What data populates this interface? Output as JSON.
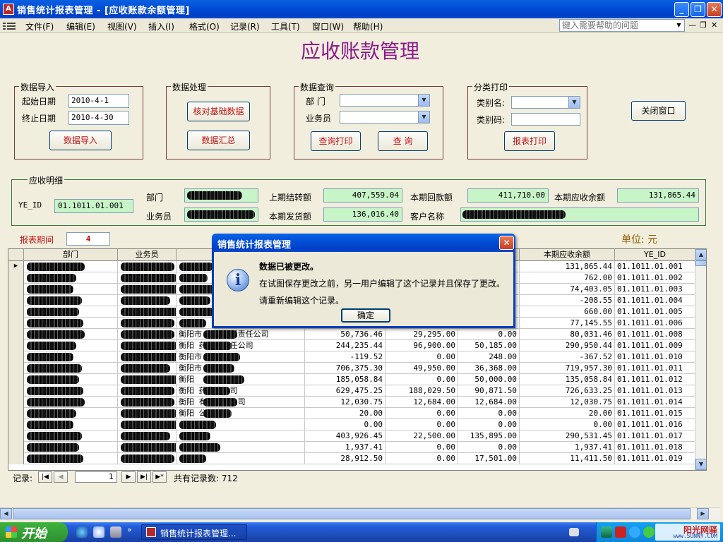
{
  "window": {
    "title": "销售统计报表管理 - [应收账款余额管理]"
  },
  "menu": [
    "文件(F)",
    "编辑(E)",
    "视图(V)",
    "插入(I)",
    "格式(O)",
    "记录(R)",
    "工具(T)",
    "窗口(W)",
    "帮助(H)"
  ],
  "help_box": {
    "placeholder": "键入需要帮助的问题"
  },
  "form_title": "应收账款管理",
  "import_group": {
    "legend": "数据导入",
    "start_label": "起始日期",
    "start_value": "2010-4-1",
    "end_label": "终止日期",
    "end_value": "2010-4-30",
    "button": "数据导入"
  },
  "process_group": {
    "legend": "数据处理",
    "check_button": "核对基础数据",
    "summary_button": "数据汇总"
  },
  "query_group": {
    "legend": "数据查询",
    "dept_label": "部  门",
    "sales_label": "业务员",
    "print_button": "查询打印",
    "query_button": "查  询"
  },
  "print_group": {
    "legend": "分类打印",
    "category_name_label": "类别名:",
    "category_code_label": "类别码:",
    "print_button": "报表打印"
  },
  "close_button": "关闭窗口",
  "detail": {
    "legend": "应收明细",
    "ye_id_label": "YE_ID",
    "ye_id_value": "01.1011.01.001",
    "dept_label": "部门",
    "sales_label": "业务员",
    "prev_balance_label": "上期结转额",
    "prev_balance_value": "407,559.04",
    "shipped_label": "本期发货额",
    "shipped_value": "136,016.40",
    "received_label": "本期回款额",
    "received_value": "411,710.00",
    "customer_label": "客户名称",
    "current_balance_label": "本期应收余额",
    "current_balance_value": "131,865.44"
  },
  "period": {
    "label": "报表期间",
    "value": "4"
  },
  "unit_label": "单位: 元",
  "grid": {
    "headers": [
      "部门",
      "业务员",
      "",
      "",
      "",
      "",
      "本期应收余额",
      "YE_ID"
    ],
    "rows": [
      {
        "customer": "",
        "c1": "",
        "c2": "",
        "c3": "",
        "bal": "131,865.44",
        "id": "01.1011.01.001"
      },
      {
        "customer": "",
        "c1": "",
        "c2": "",
        "c3": "",
        "bal": "762.00",
        "id": "01.1011.01.002"
      },
      {
        "customer": "",
        "c1": "",
        "c2": "",
        "c3": "",
        "bal": "74,403.05",
        "id": "01.1011.01.003"
      },
      {
        "customer": "",
        "c1": "",
        "c2": "",
        "c3": "",
        "bal": "-208.55",
        "id": "01.1011.01.004"
      },
      {
        "customer": "",
        "c1": "",
        "c2": "",
        "c3": "",
        "bal": "660.00",
        "id": "01.1011.01.005"
      },
      {
        "customer": "",
        "c1": "",
        "c2": "",
        "c3": "",
        "bal": "77,145.55",
        "id": "01.1011.01.006"
      },
      {
        "customer": "衡阳市  药品有限责任公司",
        "c1": "50,736.46",
        "c2": "29,295.00",
        "c3": "0.00",
        "bal": "80,031.46",
        "id": "01.1011.01.008"
      },
      {
        "customer": "衡阳  药有限责任公司",
        "c1": "244,235.44",
        "c2": "96,900.00",
        "c3": "50,185.00",
        "bal": "290,950.44",
        "id": "01.1011.01.009"
      },
      {
        "customer": "衡阳市",
        "c1": "-119.52",
        "c2": "0.00",
        "c3": "248.00",
        "bal": "-367.52",
        "id": "01.1011.01.010"
      },
      {
        "customer": "衡阳市",
        "c1": "706,375.30",
        "c2": "49,950.00",
        "c3": "36,368.00",
        "bal": "719,957.30",
        "id": "01.1011.01.011"
      },
      {
        "customer": "衡阳",
        "c1": "185,058.84",
        "c2": "0.00",
        "c3": "50,000.00",
        "bal": "135,058.84",
        "id": "01.1011.01.012"
      },
      {
        "customer": "衡阳  药有限公司",
        "c1": "629,475.25",
        "c2": "188,029.50",
        "c3": "90,871.50",
        "bal": "726,633.25",
        "id": "01.1011.01.013"
      },
      {
        "customer": "衡阳  有限责任公司",
        "c1": "12,030.75",
        "c2": "12,684.00",
        "c3": "12,684.00",
        "bal": "12,030.75",
        "id": "01.1011.01.014"
      },
      {
        "customer": "衡阳  公司",
        "c1": "20.00",
        "c2": "0.00",
        "c3": "0.00",
        "bal": "20.00",
        "id": "01.1011.01.015"
      },
      {
        "customer": "",
        "c1": "0.00",
        "c2": "0.00",
        "c3": "0.00",
        "bal": "0.00",
        "id": "01.1011.01.016"
      },
      {
        "customer": "",
        "c1": "403,926.45",
        "c2": "22,500.00",
        "c3": "135,895.00",
        "bal": "290,531.45",
        "id": "01.1011.01.017"
      },
      {
        "customer": "",
        "c1": "1,937.41",
        "c2": "0.00",
        "c3": "0.00",
        "bal": "1,937.41",
        "id": "01.1011.01.018"
      },
      {
        "customer": "",
        "c1": "28,912.50",
        "c2": "0.00",
        "c3": "17,501.00",
        "bal": "11,411.50",
        "id": "01.1011.01.019"
      }
    ]
  },
  "navigator": {
    "label": "记录:",
    "current": "1",
    "total_text": "共有记录数: 712"
  },
  "dialog": {
    "title": "销售统计报表管理",
    "line1": "数据已被更改。",
    "line2": "在试图保存更改之前，另一用户编辑了这个记录并且保存了更改。",
    "line3": "请重新编辑这个记录。",
    "ok": "确定"
  },
  "taskbar": {
    "start": "开始",
    "task": "销售统计报表管理..."
  },
  "watermark": {
    "cn": "阳光网驿",
    "en": "www.SUNNY.COM"
  },
  "colors": {
    "title_purple": "#8b1a8b",
    "button_red": "#c01010",
    "detail_green": "#c8f5c8"
  }
}
